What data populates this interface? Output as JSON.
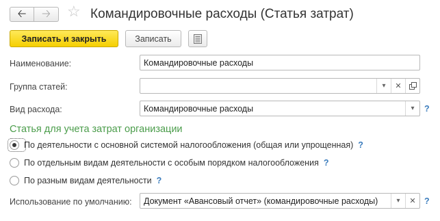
{
  "header": {
    "title": "Командировочные расходы (Статья затрат)",
    "back_icon": "arrow-left",
    "forward_icon": "arrow-right",
    "favorite_icon": "star-outline"
  },
  "toolbar": {
    "save_close_label": "Записать и закрыть",
    "save_label": "Записать",
    "more_icon": "document-list"
  },
  "form": {
    "name": {
      "label": "Наименование:",
      "value": "Командировочные расходы"
    },
    "group": {
      "label": "Группа статей:",
      "value": ""
    },
    "expense_type": {
      "label": "Вид расхода:",
      "value": "Командировочные расходы",
      "help": "?"
    },
    "section_title": "Статья для учета затрат организации",
    "options": [
      {
        "label": "По деятельности с основной системой налогообложения (общая или упрощенная)",
        "help": "?",
        "selected": true
      },
      {
        "label": "По отдельным видам деятельности с особым порядком налогообложения",
        "help": "?",
        "selected": false
      },
      {
        "label": "По разным видам деятельности",
        "help": "?",
        "selected": false
      }
    ],
    "default_usage": {
      "label": "Использование по умолчанию:",
      "value": "Документ «Авансовый отчет» (командировочные расходы)",
      "help": "?"
    }
  },
  "colors": {
    "accent_yellow": "#f5cf00",
    "section_green": "#4a9c4a",
    "help_blue": "#3c7dbd"
  }
}
